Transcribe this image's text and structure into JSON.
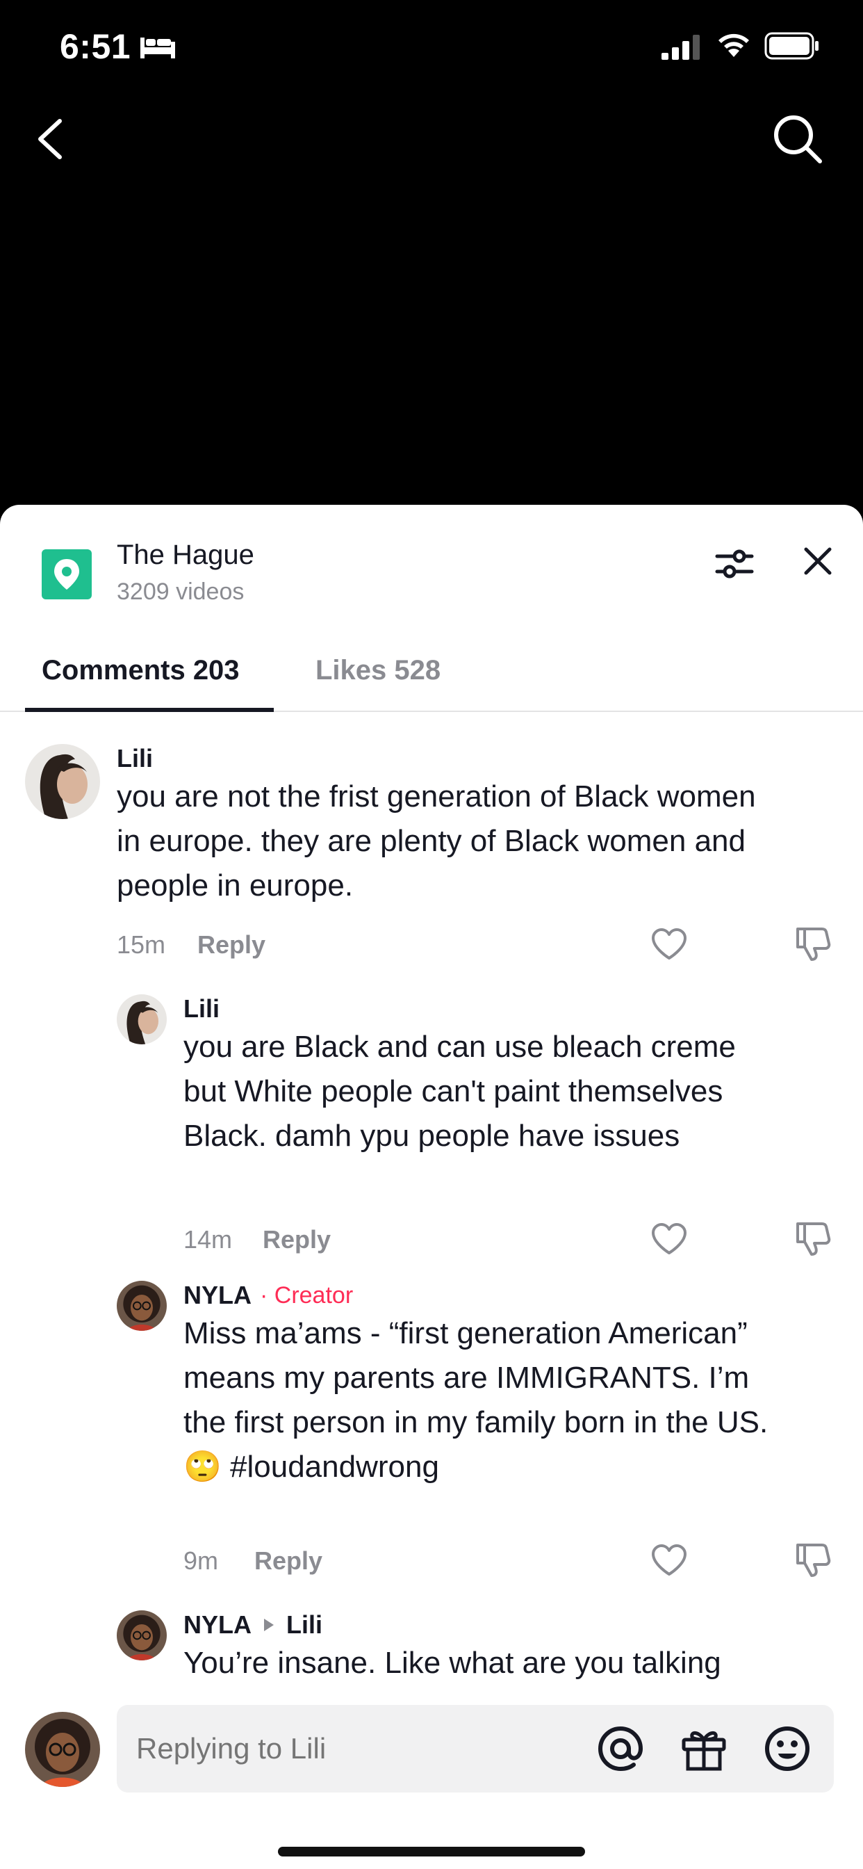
{
  "status": {
    "time": "6:51"
  },
  "location": {
    "title": "The Hague",
    "videos": "3209 videos"
  },
  "tabs": {
    "comments": "Comments 203",
    "likes": "Likes 528"
  },
  "comments": [
    {
      "user": "Lili",
      "text": "you are not the frist generation of Black women in europe. they are plenty of Black women and people in europe.",
      "time": "15m",
      "reply": "Reply"
    },
    {
      "user": "Lili",
      "text": "you are Black and can use bleach creme but White people can't paint themselves Black. damh ypu people have issues",
      "time": "14m",
      "reply": "Reply"
    },
    {
      "user": "NYLA",
      "badge": "· Creator",
      "text": "Miss ma’ams - “first generation American” means my parents are IMMIGRANTS. I’m the first person in my family born in the US. 🙄 #loudandwrong",
      "time": "9m",
      "reply": "Reply"
    },
    {
      "user": "NYLA",
      "reply_to": "Lili",
      "text": "You’re insane. Like what are you talking"
    }
  ],
  "input": {
    "placeholder": "Replying to Lili"
  },
  "colors": {
    "accent": "#fe2c55",
    "location_badge": "#1fbf8f"
  }
}
